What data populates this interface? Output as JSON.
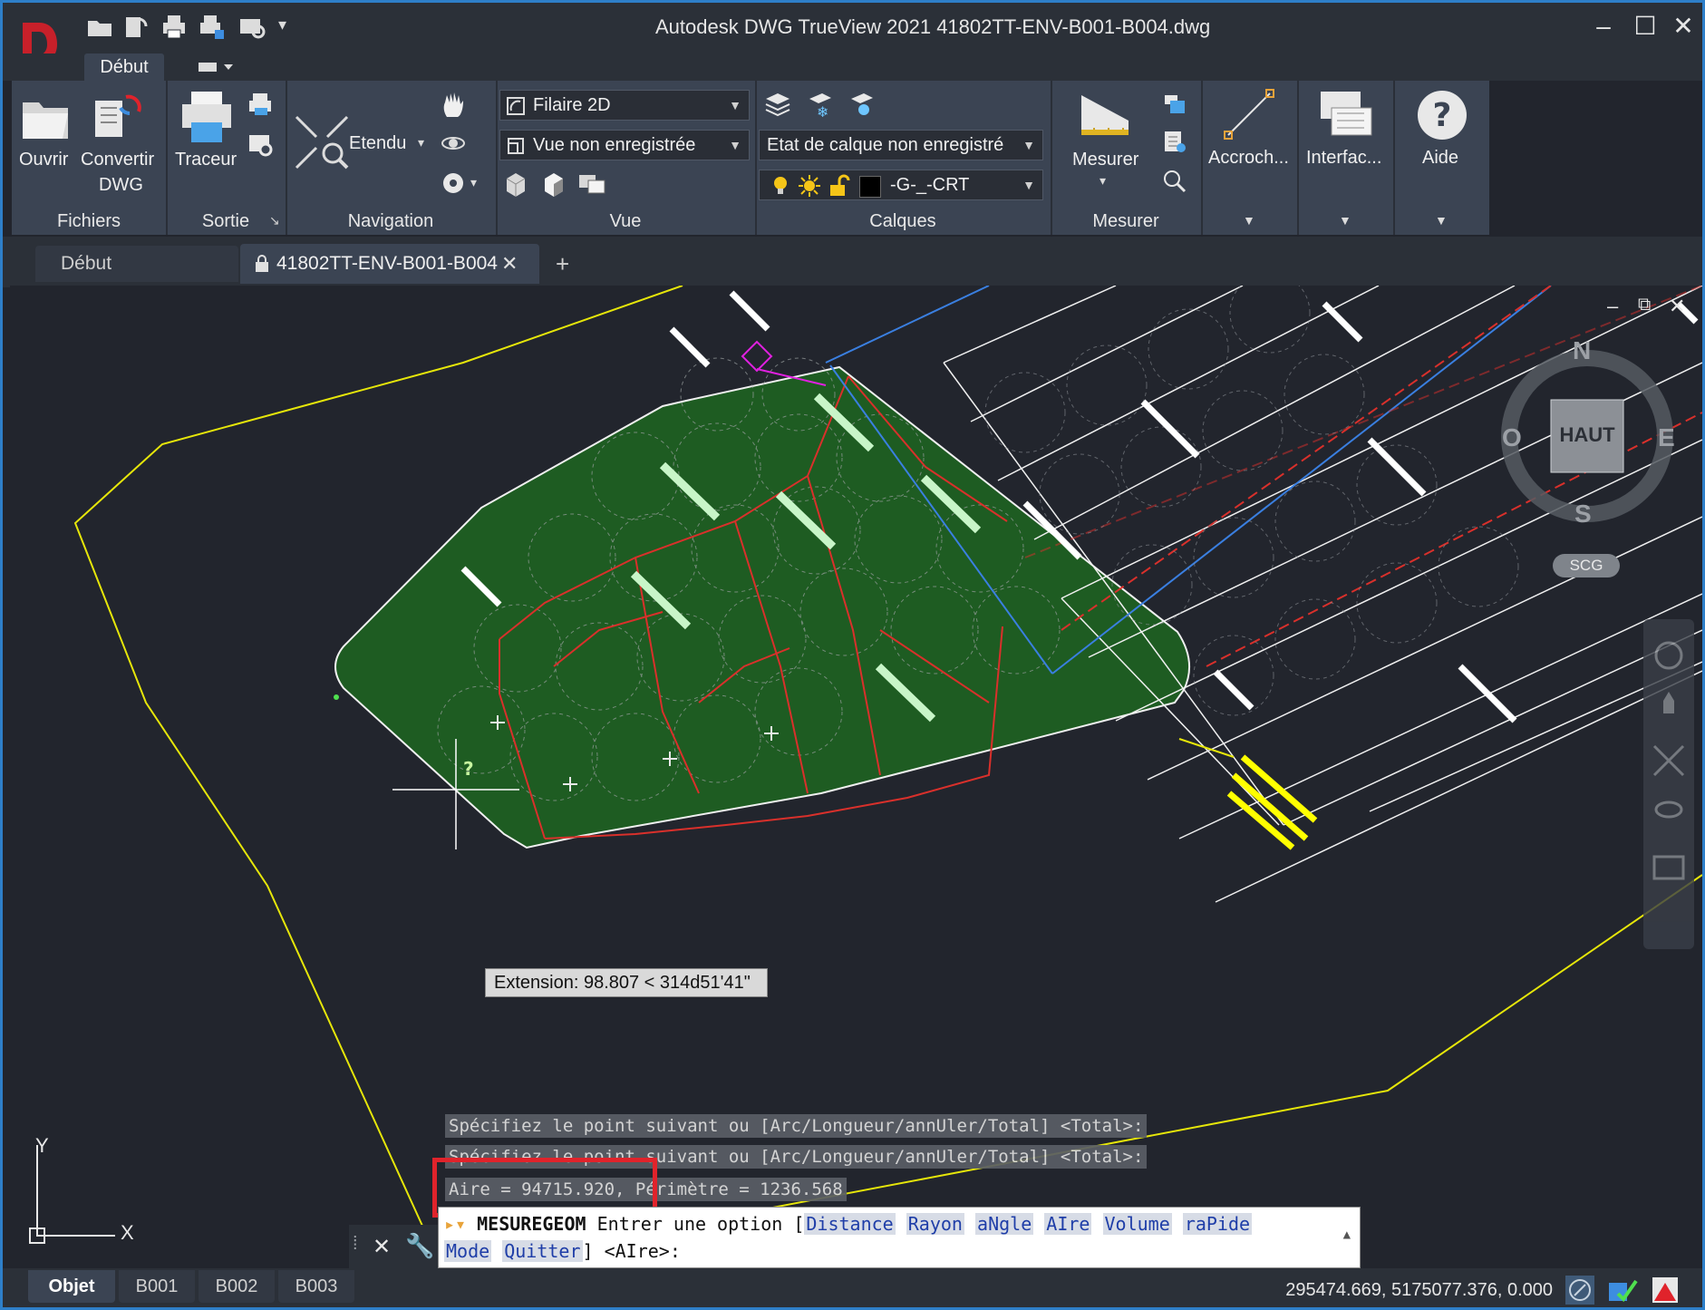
{
  "window": {
    "title": "Autodesk DWG TrueView 2021    41802TT-ENV-B001-B004.dwg",
    "minimize": "–",
    "maximize": "☐",
    "close": "✕"
  },
  "ribbon": {
    "active_tab": "Début",
    "buttons": {
      "ouvrir": "Ouvrir",
      "convertir_line1": "Convertir",
      "convertir_line2": "DWG",
      "traceur": "Traceur",
      "etendu": "Etendu",
      "mesurer": "Mesurer",
      "accroch": "Accroch...",
      "interfac": "Interfac...",
      "aide": "Aide"
    },
    "combos": {
      "visual_style": "Filaire 2D",
      "named_view": "Vue non enregistrée",
      "layer_state": "Etat de calque non enregistré",
      "layer": "-G-_-CRT"
    },
    "panels": {
      "fichiers": "Fichiers",
      "sortie": "Sortie",
      "navigation": "Navigation",
      "vue": "Vue",
      "calques": "Calques",
      "mesurer": "Mesurer"
    }
  },
  "doc_tabs": {
    "start": "Début",
    "active": "41802TT-ENV-B001-B004",
    "close": "✕",
    "add": "+"
  },
  "viewcube": {
    "north": "N",
    "south": "S",
    "east": "E",
    "west": "O",
    "face": "HAUT",
    "ucs_menu": "SCG"
  },
  "ucs_icon": {
    "x": "X",
    "y": "Y"
  },
  "tooltip": {
    "extension": "Extension: 98.807 < 314d51'41\""
  },
  "command": {
    "history": [
      "Spécifiez le point suivant ou [Arc/Longueur/annUler/Total] <Total>:",
      "Spécifiez le point suivant ou [Arc/Longueur/annUler/Total] <Total>:"
    ],
    "result": "Aire = 94715.920, Périmètre = 1236.568",
    "command_name": "MESUREGEOM",
    "prompt_text": "Entrer une option [",
    "options_line1": [
      "Distance",
      "Rayon",
      "aNgle",
      "AIre",
      "Volume",
      "raPide"
    ],
    "options_line2_mode": "Mode",
    "options_line2_quit": "Quitter",
    "prompt_tail": "] <AIre>:"
  },
  "layout_tabs": [
    "Objet",
    "B001",
    "B002",
    "B003"
  ],
  "status": {
    "coordinates": "295474.669, 5175077.376, 0.000"
  },
  "colors": {
    "accent_blue": "#2e7fc9",
    "fill_green": "#1e5c22",
    "highlight_red": "#e0232b",
    "boundary_yellow": "#e6e60a"
  }
}
